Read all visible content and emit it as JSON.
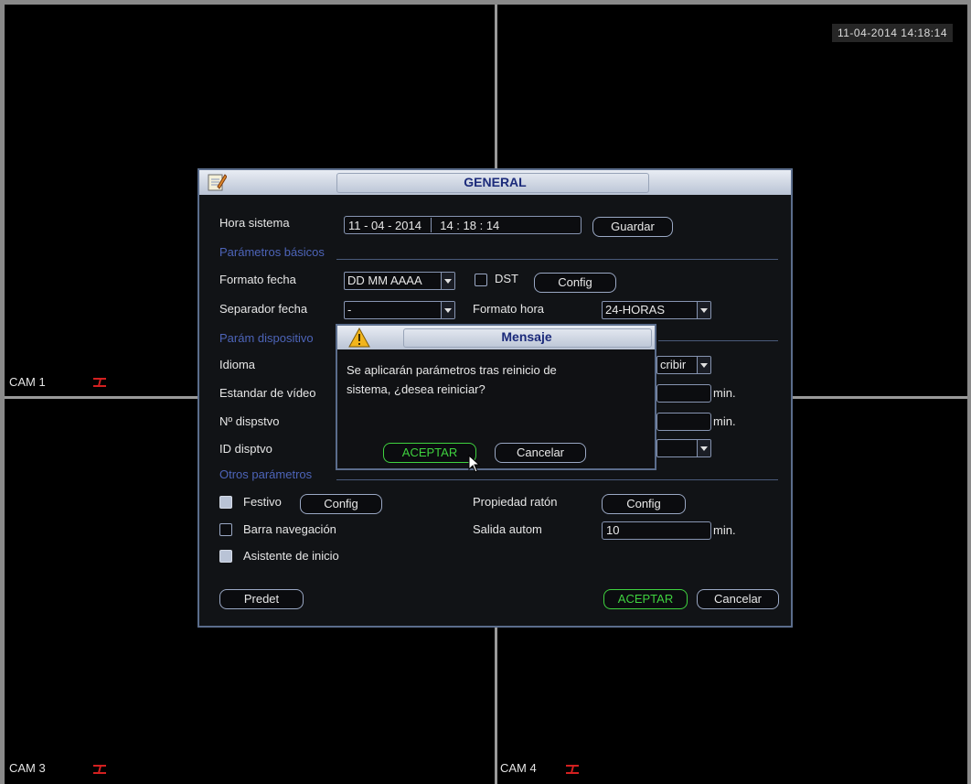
{
  "clock": "11-04-2014 14:18:14",
  "cameras": [
    {
      "label": "CAM 1"
    },
    {
      "label": "CAM 3"
    },
    {
      "label": "CAM 4"
    }
  ],
  "general": {
    "title": "GENERAL",
    "system_time_label": "Hora sistema",
    "date_value": "11 - 04 - 2014",
    "time_value": "14 : 18 : 14",
    "save_button": "Guardar",
    "basic_section": "Parámetros básicos",
    "date_format_label": "Formato fecha",
    "date_format_value": "DD MM AAAA",
    "dst_label": "DST",
    "dst_config_button": "Config",
    "date_separator_label": "Separador fecha",
    "date_separator_value": "-",
    "time_format_label": "Formato hora",
    "time_format_value": "24-HORAS",
    "device_section": "Parám dispositivo",
    "language_label": "Idioma",
    "overwrite_value": "cribir",
    "video_standard_label": "Estandar de vídeo",
    "device_no_label": "Nº dispstvo",
    "device_id_label": "ID disptvo",
    "min_unit": "min.",
    "other_section": "Otros parámetros",
    "holiday_label": "Festivo",
    "holiday_config_button": "Config",
    "mouse_property_label": "Propiedad ratón",
    "mouse_config_button": "Config",
    "navbar_label": "Barra navegación",
    "auto_logout_label": "Salida autom",
    "auto_logout_value": "10",
    "startup_wizard_label": "Asistente de inicio",
    "default_button": "Predet",
    "accept_button": "ACEPTAR",
    "cancel_button": "Cancelar"
  },
  "message": {
    "title": "Mensaje",
    "text_line1": "Se aplicarán parámetros tras reinicio de",
    "text_line2": "sistema, ¿desea reiniciar?",
    "accept_button": "ACEPTAR",
    "cancel_button": "Cancelar"
  },
  "colors": {
    "accent_green": "#3fd23f",
    "section_blue": "#4d64b8",
    "title_blue": "#1b2a7a",
    "alarm_red": "#d32020"
  },
  "icons": [
    "notepad-icon",
    "warning-icon",
    "record-icon",
    "mouse-pointer-icon",
    "dropdown-arrow-icon"
  ]
}
